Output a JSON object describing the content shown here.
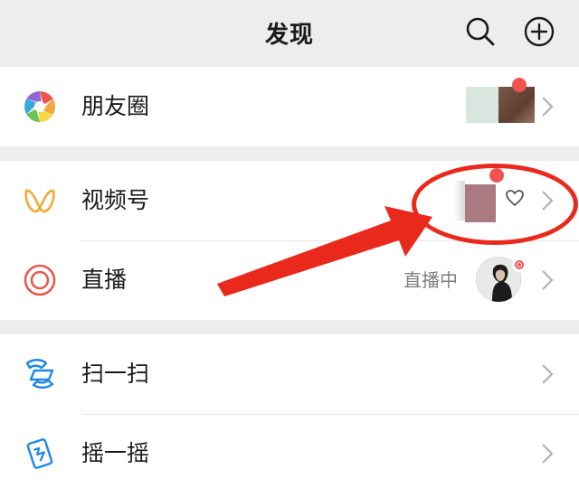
{
  "header": {
    "title": "发现",
    "search_icon": "search-icon",
    "add_icon": "plus-circle-icon"
  },
  "rows": {
    "moments": {
      "label": "朋友圈",
      "icon": "moments-aperture-icon"
    },
    "channels": {
      "label": "视频号",
      "icon": "channels-icon"
    },
    "live": {
      "label": "直播",
      "status": "直播中",
      "icon": "live-icon"
    },
    "scan": {
      "label": "扫一扫",
      "icon": "scan-icon"
    },
    "shake": {
      "label": "摇一摇",
      "icon": "shake-icon"
    }
  },
  "colors": {
    "background": "#ededed",
    "accent_red": "#f25350",
    "annotation_red": "#e8291c",
    "channels_orange": "#f3a93a",
    "scan_blue": "#1e88e5"
  }
}
